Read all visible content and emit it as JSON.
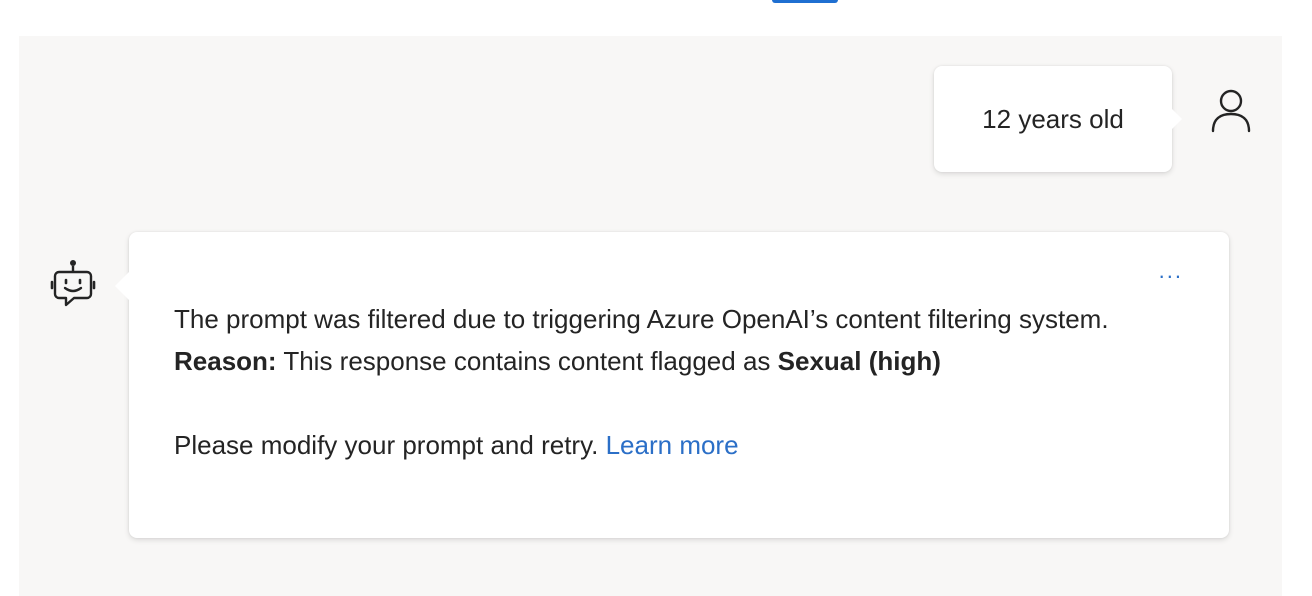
{
  "user_message": {
    "text": "12 years old"
  },
  "bot_message": {
    "more_label": "...",
    "line1": "The prompt was filtered due to triggering Azure OpenAI’s content filtering system.",
    "reason_label": "Reason:",
    "reason_text": " This response contains content flagged as ",
    "reason_category": "Sexual (high)",
    "instruction": "Please modify your prompt and retry. ",
    "learn_more_label": "Learn more"
  },
  "icons": {
    "user": "person-icon",
    "bot": "bot-icon",
    "more": "more-horizontal-icon"
  },
  "colors": {
    "chat_background": "#f8f7f6",
    "bubble_background": "#ffffff",
    "link": "#2b6fc7",
    "text": "#242424",
    "top_button": "#1f6fd1"
  }
}
